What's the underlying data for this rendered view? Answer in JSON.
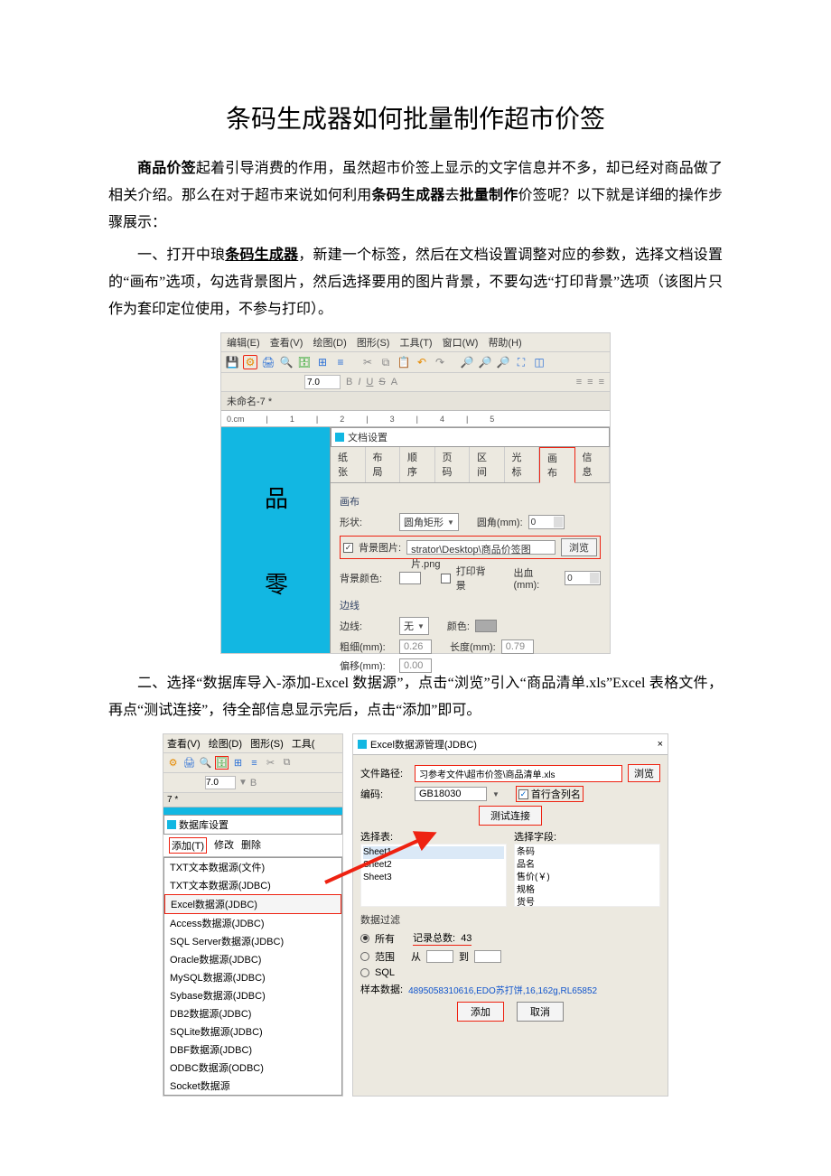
{
  "title": "条码生成器如何批量制作超市价签",
  "para1": {
    "s1a": "商品价签",
    "s1b": "起着引导消费的作用，虽然超市价签上显示的文字信息并不多，却已经对商品做了相关介绍。那么在对于超市来说如何利用",
    "s1c": "条码生成器",
    "s1d": "去",
    "s1e": "批量制作",
    "s1f": "价签呢？以下就是详细的操作步骤展示："
  },
  "para2": {
    "s2a": "一、打开中琅",
    "s2b": "条码生成器",
    "s2c": "，新建一个标签，然后在文档设置调整对应的参数，选择文档设置的“画布”选项，勾选背景图片，然后选择要用的图片背景，不要勾选“打印背景”选项（该图片只作为套印定位使用，不参与打印）。"
  },
  "para3": "二、选择“数据库导入-添加-Excel 数据源”，点击“浏览”引入“商品清单.xls”Excel 表格文件，再点“测试连接”，待全部信息显示完后，点击“添加”即可。",
  "fig1": {
    "menu": {
      "edit": "编辑(E)",
      "view": "查看(V)",
      "draw": "绘图(D)",
      "shape": "图形(S)",
      "tool": "工具(T)",
      "window": "窗口(W)",
      "help": "帮助(H)"
    },
    "fontSize": "7.0",
    "tabName": "未命名-7 *",
    "ruler": "0.cm",
    "leftChars": {
      "c1": "品",
      "c2": "零"
    },
    "dlg": {
      "title": "文档设置",
      "tabs": {
        "paper": "纸张",
        "layout": "布局",
        "order": "顺序",
        "page": "页码",
        "range": "区间",
        "cursor": "光标",
        "canvas": "画布",
        "info": "信息"
      },
      "sectCanvas": "画布",
      "shapeLabel": "形状:",
      "shapeVal": "圆角矩形",
      "cornerLabel": "圆角(mm):",
      "cornerVal": "0",
      "bgChkLabel": "背景图片:",
      "bgPath": "strator\\Desktop\\商品价签图片.png",
      "browse": "浏览",
      "bgColorLabel": "背景颜色:",
      "printBgLabel": "打印背景",
      "bleedLabel": "出血(mm):",
      "bleedVal": "0",
      "sectBorder": "边线",
      "borderLabel": "边线:",
      "borderVal": "无",
      "colorLabel": "颜色:",
      "thickLabel": "粗细(mm):",
      "thickVal": "0.26",
      "lenLabel": "长度(mm):",
      "lenVal": "0.79",
      "offsetLabel": "偏移(mm):",
      "offsetVal": "0.00"
    }
  },
  "fig2": {
    "menu": {
      "view": "查看(V)",
      "draw": "绘图(D)",
      "shape": "图形(S)",
      "tool": "工具("
    },
    "fontSize": "7.0",
    "tabName": "7 *",
    "dbTitle": "数据库设置",
    "dbHeader": {
      "add": "添加(T)",
      "edit": "修改",
      "del": "删除"
    },
    "dropdown": [
      "TXT文本数据源(文件)",
      "TXT文本数据源(JDBC)",
      "Excel数据源(JDBC)",
      "Access数据源(JDBC)",
      "SQL Server数据源(JDBC)",
      "Oracle数据源(JDBC)",
      "MySQL数据源(JDBC)",
      "Sybase数据源(JDBC)",
      "DB2数据源(JDBC)",
      "SQLite数据源(JDBC)",
      "DBF数据源(JDBC)",
      "ODBC数据源(ODBC)",
      "Socket数据源"
    ],
    "right": {
      "title": "Excel数据源管理(JDBC)",
      "pathLabel": "文件路径:",
      "pathVal": "习参考文件\\超市价签\\商品清单.xls",
      "browse": "浏览",
      "encLabel": "编码:",
      "encVal": "GB18030",
      "firstRowLabel": "首行含列名",
      "test": "测试连接",
      "selTable": "选择表:",
      "selField": "选择字段:",
      "tables": [
        "Sheet1",
        "Sheet2",
        "Sheet3"
      ],
      "fields": [
        "条码",
        "品名",
        "售价(￥)",
        "规格",
        "货号"
      ],
      "filter": "数据过滤",
      "radioAll": "所有",
      "recTotalLabel": "记录总数:",
      "recTotal": "43",
      "radioRange": "范围",
      "from": "从",
      "to": "到",
      "radioSql": "SQL",
      "sampleLabel": "样本数据:",
      "sampleVal": "4895058310616,EDO苏打饼,16,162g,RL65852",
      "add": "添加",
      "cancel": "取消"
    }
  }
}
